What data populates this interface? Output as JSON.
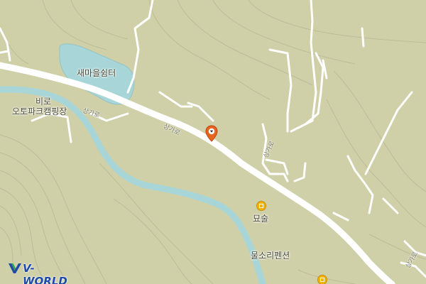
{
  "map": {
    "place_labels": {
      "rest_area": "새마을쉼터",
      "camping_line1": "비로",
      "camping_line2": "오토파크캠핑장",
      "restaurant": "묘술",
      "pension": "물소리펜션"
    },
    "road_labels": {
      "road_1": "상가로",
      "road_2": "상가로",
      "road_3": "상가로",
      "road_4": "상가로"
    },
    "poi_icons": [
      "restaurant-icon",
      "lodging-icon"
    ],
    "marker": "location-pin-icon",
    "logo": "V-WORLD",
    "colors": {
      "land": "#cfcfa8",
      "water": "#a8d6d8",
      "road": "#ffffff",
      "pin": "#e8641e",
      "poi": "#f2b400",
      "logo": "#1e4aa8"
    }
  }
}
